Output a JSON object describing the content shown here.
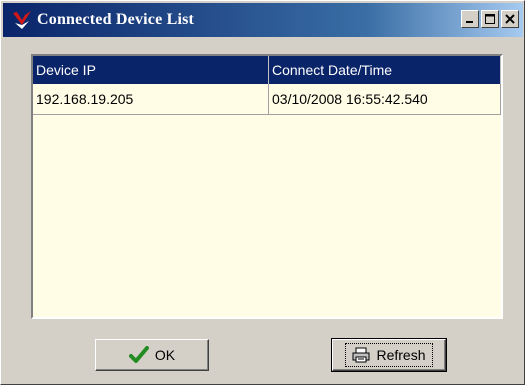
{
  "window": {
    "title": "Connected Device List",
    "controls": [
      "minimize",
      "maximize",
      "close"
    ]
  },
  "table": {
    "columns": [
      "Device IP",
      "Connect Date/Time"
    ],
    "rows": [
      [
        "192.168.19.205",
        "03/10/2008 16:55:42.540"
      ]
    ]
  },
  "buttons": {
    "ok_label": "OK",
    "ok_icon": "checkmark-icon",
    "refresh_label": "Refresh",
    "refresh_icon": "printer-icon"
  },
  "colors": {
    "header_bg": "#0a246a",
    "grid_bg": "#fffde6",
    "check_green": "#228b22"
  }
}
